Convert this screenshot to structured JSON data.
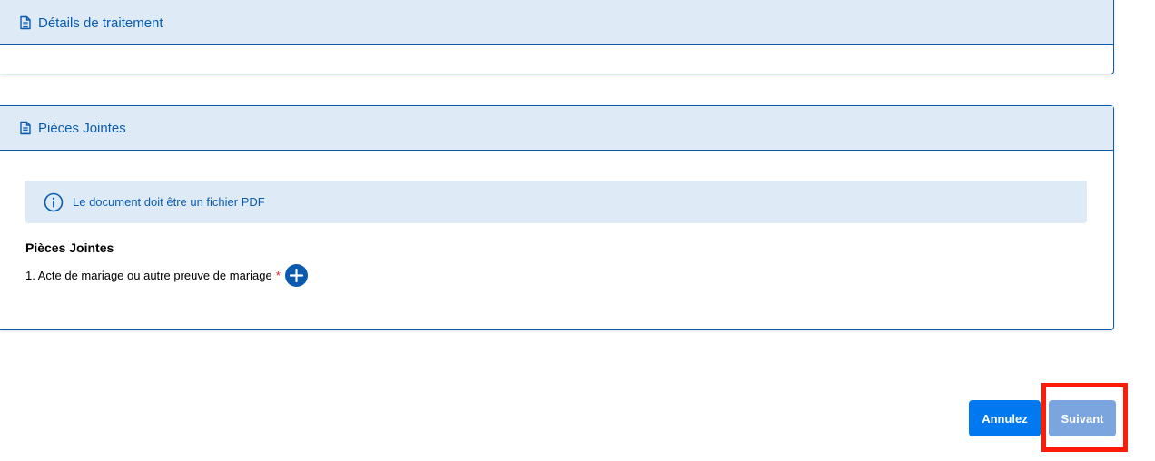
{
  "panels": {
    "processing": {
      "title": "Détails de traitement",
      "icon": "document-icon"
    },
    "attachments": {
      "title": "Pièces Jointes",
      "icon": "document-icon",
      "info_text": "Le document doit être un fichier PDF",
      "info_icon": "info-icon",
      "section_title": "Pièces Jointes",
      "items": [
        {
          "label": "1. Acte de mariage ou autre preuve de mariage",
          "required_mark": "*"
        }
      ]
    }
  },
  "buttons": {
    "cancel_label": "Annulez",
    "next_label": "Suivant"
  },
  "colors": {
    "primary": "#0a5bb0",
    "header_bg": "#deebf7",
    "cancel_button": "#0078f0",
    "next_button_disabled": "#7aa5df",
    "required": "#e0202a",
    "highlight": "#ff1a0a"
  }
}
